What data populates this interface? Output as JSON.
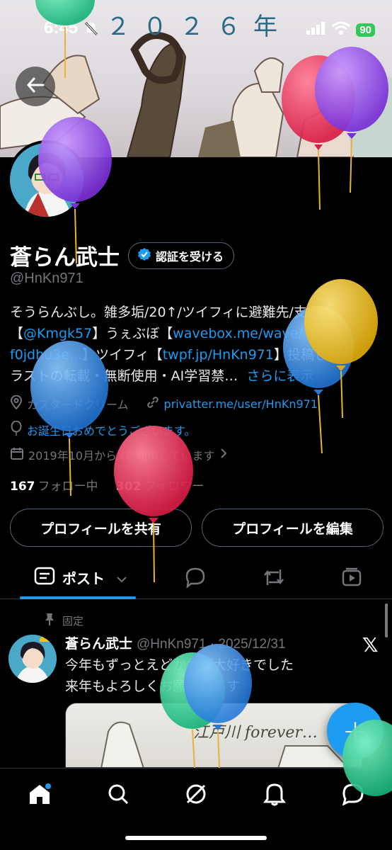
{
  "status_bar": {
    "time": "6:45",
    "battery": "90"
  },
  "banner": {
    "text": "２０２６年"
  },
  "profile": {
    "display_name": "蒼らん武士",
    "verify_label": "認証を受ける",
    "handle": "@HnKn971",
    "bio": {
      "line1": "そうらんぶし。雑多垢/20↑/ツイフィに避難先/支",
      "line2_pre": "【",
      "line2_link": "@Kmgk57",
      "line2_mid": "】うぇぶぼ【",
      "line2_link2": "wavebox.me/wave/",
      "line3_link": "f0jdhu3e...",
      "line3_mid": "】ツイフィ【",
      "line3_link2": "twpf.jp/HnKn971",
      "line3_post": "】投稿したイ",
      "line4": "ラストの転載・無断使用・AI学習禁…",
      "more": "さらに表示"
    },
    "location": "カスタードクリーム",
    "website": "privatter.me/user/HnKn971",
    "birthday": "お誕生日おめでとうございます。",
    "joined": "2019年10月からXを利用しています",
    "following_count": "167",
    "following_label": "フォロー中",
    "followers_count": "302",
    "followers_label": "フォロワー",
    "share_button": "プロフィールを共有",
    "edit_button": "プロフィールを編集"
  },
  "tabs": {
    "post_label": "ポスト"
  },
  "pinned_post": {
    "pinned_label": "固定",
    "author": "蒼らん武士",
    "meta": "@HnKn971 · 2025/12/31",
    "line1": "今年もずっとえどかわが大好きでした",
    "line2": "来年もよろしくお願いします",
    "image_text": "江戸川 forever…"
  },
  "fab": {
    "label": "+"
  },
  "colors": {
    "accent": "#1d9bf0",
    "balloon_green": "#22c585",
    "balloon_purple": "#8a3fe0",
    "balloon_red": "#e8234a",
    "balloon_blue": "#2f8fe6",
    "balloon_yellow": "#f0c11a"
  },
  "icons": [
    "back-arrow-icon",
    "silent-bell-icon",
    "signal-icon",
    "wifi-icon",
    "verified-badge-icon",
    "location-icon",
    "link-icon",
    "balloon-icon",
    "calendar-icon",
    "chevron-right-icon",
    "post-tab-icon",
    "chevron-down-icon",
    "reply-tab-icon",
    "repost-tab-icon",
    "media-tab-icon",
    "pin-icon",
    "x-logo-icon",
    "home-icon",
    "search-icon",
    "grok-icon",
    "notifications-icon",
    "messages-icon"
  ]
}
